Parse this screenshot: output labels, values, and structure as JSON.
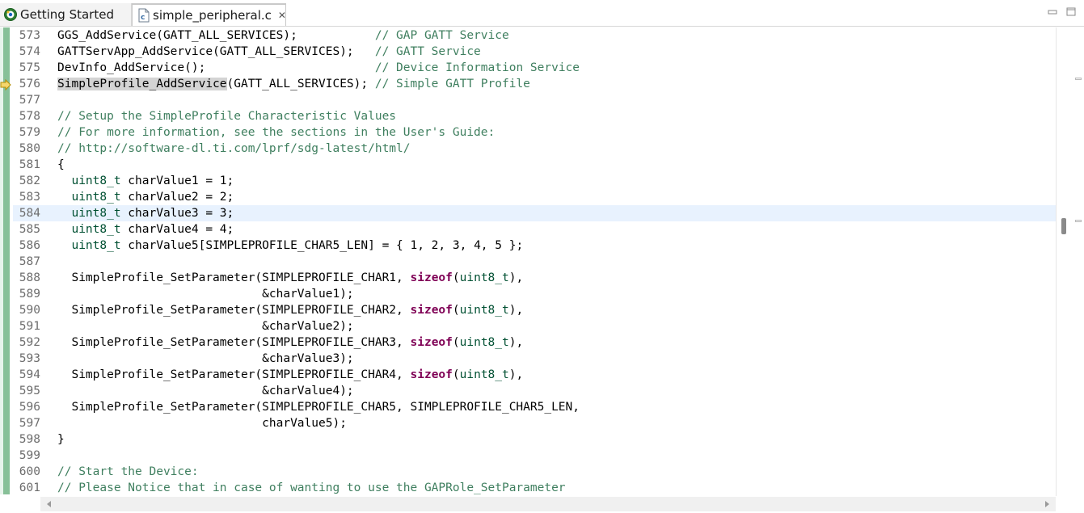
{
  "tabs": [
    {
      "label": "Getting Started",
      "icon": "gear-globe-icon",
      "active": false
    },
    {
      "label": "simple_peripheral.c",
      "icon": "c-file-icon",
      "active": true,
      "close": "✕"
    }
  ],
  "editor": {
    "current_line": 584,
    "lines": [
      {
        "n": "573",
        "parts": [
          [
            "",
            "GGS_AddService(GATT_ALL_SERVICES);           "
          ],
          [
            "cm",
            "// GAP GATT Service"
          ]
        ]
      },
      {
        "n": "574",
        "parts": [
          [
            "",
            "GATTServApp_AddService(GATT_ALL_SERVICES);   "
          ],
          [
            "cm",
            "// GATT Service"
          ]
        ]
      },
      {
        "n": "575",
        "parts": [
          [
            "",
            "DevInfo_AddService();                        "
          ],
          [
            "cm",
            "// Device Information Service"
          ]
        ]
      },
      {
        "n": "576",
        "parts": [
          [
            "hl",
            "SimpleProfile_AddService"
          ],
          [
            "",
            "(GATT_ALL_SERVICES); "
          ],
          [
            "cm",
            "// Simple GATT Profile"
          ]
        ]
      },
      {
        "n": "577",
        "parts": []
      },
      {
        "n": "578",
        "parts": [
          [
            "cm",
            "// Setup the SimpleProfile Characteristic Values"
          ]
        ]
      },
      {
        "n": "579",
        "parts": [
          [
            "cm",
            "// For more information, see the sections in the User's Guide:"
          ]
        ]
      },
      {
        "n": "580",
        "parts": [
          [
            "cm",
            "// http://software-dl.ti.com/lprf/sdg-latest/html/"
          ]
        ]
      },
      {
        "n": "581",
        "parts": [
          [
            "",
            "{"
          ]
        ]
      },
      {
        "n": "582",
        "parts": [
          [
            "",
            "  "
          ],
          [
            "ty",
            "uint8_t"
          ],
          [
            "",
            " charValue1 = 1;"
          ]
        ]
      },
      {
        "n": "583",
        "parts": [
          [
            "",
            "  "
          ],
          [
            "ty",
            "uint8_t"
          ],
          [
            "",
            " charValue2 = 2;"
          ]
        ]
      },
      {
        "n": "584",
        "parts": [
          [
            "",
            "  "
          ],
          [
            "ty",
            "uint8_t"
          ],
          [
            "",
            " charValue3 = 3;"
          ]
        ]
      },
      {
        "n": "585",
        "parts": [
          [
            "",
            "  "
          ],
          [
            "ty",
            "uint8_t"
          ],
          [
            "",
            " charValue4 = 4;"
          ]
        ]
      },
      {
        "n": "586",
        "parts": [
          [
            "",
            "  "
          ],
          [
            "ty",
            "uint8_t"
          ],
          [
            "",
            " charValue5[SIMPLEPROFILE_CHAR5_LEN] = { 1, 2, 3, 4, 5 };"
          ]
        ]
      },
      {
        "n": "587",
        "parts": []
      },
      {
        "n": "588",
        "parts": [
          [
            "",
            "  SimpleProfile_SetParameter(SIMPLEPROFILE_CHAR1, "
          ],
          [
            "kw",
            "sizeof"
          ],
          [
            "",
            "("
          ],
          [
            "ty",
            "uint8_t"
          ],
          [
            "",
            "),"
          ]
        ]
      },
      {
        "n": "589",
        "parts": [
          [
            "",
            "                             &charValue1);"
          ]
        ]
      },
      {
        "n": "590",
        "parts": [
          [
            "",
            "  SimpleProfile_SetParameter(SIMPLEPROFILE_CHAR2, "
          ],
          [
            "kw",
            "sizeof"
          ],
          [
            "",
            "("
          ],
          [
            "ty",
            "uint8_t"
          ],
          [
            "",
            "),"
          ]
        ]
      },
      {
        "n": "591",
        "parts": [
          [
            "",
            "                             &charValue2);"
          ]
        ]
      },
      {
        "n": "592",
        "parts": [
          [
            "",
            "  SimpleProfile_SetParameter(SIMPLEPROFILE_CHAR3, "
          ],
          [
            "kw",
            "sizeof"
          ],
          [
            "",
            "("
          ],
          [
            "ty",
            "uint8_t"
          ],
          [
            "",
            "),"
          ]
        ]
      },
      {
        "n": "593",
        "parts": [
          [
            "",
            "                             &charValue3);"
          ]
        ]
      },
      {
        "n": "594",
        "parts": [
          [
            "",
            "  SimpleProfile_SetParameter(SIMPLEPROFILE_CHAR4, "
          ],
          [
            "kw",
            "sizeof"
          ],
          [
            "",
            "("
          ],
          [
            "ty",
            "uint8_t"
          ],
          [
            "",
            "),"
          ]
        ]
      },
      {
        "n": "595",
        "parts": [
          [
            "",
            "                             &charValue4);"
          ]
        ]
      },
      {
        "n": "596",
        "parts": [
          [
            "",
            "  SimpleProfile_SetParameter(SIMPLEPROFILE_CHAR5, SIMPLEPROFILE_CHAR5_LEN,"
          ]
        ]
      },
      {
        "n": "597",
        "parts": [
          [
            "",
            "                             charValue5);"
          ]
        ]
      },
      {
        "n": "598",
        "parts": [
          [
            "",
            "}"
          ]
        ]
      },
      {
        "n": "599",
        "parts": []
      },
      {
        "n": "600",
        "parts": [
          [
            "cm",
            "// Start the Device:"
          ]
        ]
      },
      {
        "n": "601",
        "parts": [
          [
            "cm",
            "// Please Notice that in case of wanting to use the GAPRole_SetParameter"
          ]
        ]
      }
    ]
  },
  "colors": {
    "comment": "#3f7f5f",
    "keyword": "#7f0055",
    "type": "#005032",
    "current_line_bg": "#e8f2fe",
    "gutter_change": "#87c098"
  }
}
